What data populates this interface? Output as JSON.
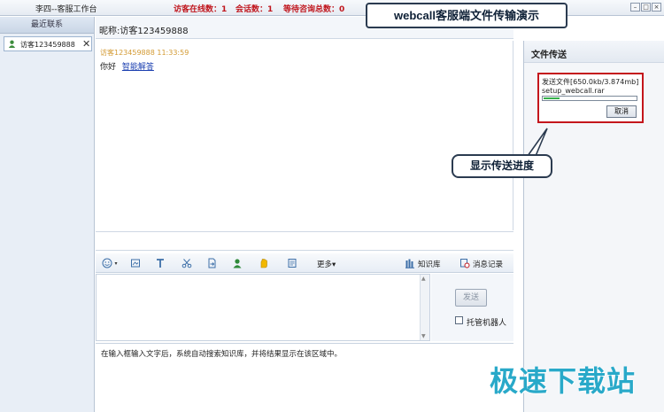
{
  "window": {
    "title": "李四--客服工作台",
    "online_visitors": "访客在线数：1",
    "sessions": "会话数：1",
    "waiting": "等待咨询总数：0",
    "controls": [
      "minimize-icon",
      "maximize-icon",
      "close-icon"
    ]
  },
  "demo_caption": "webcall客服端文件传输演示",
  "sidebar": {
    "header": "最近联系",
    "contacts": [
      {
        "name": "访客123459888",
        "icon": "visitor-avatar-icon"
      }
    ]
  },
  "conversation": {
    "nickname": "昵称:访客123459888",
    "messages": [
      {
        "meta": "访客123459888  11:33:59",
        "text": "你好",
        "link": "智能解答"
      }
    ]
  },
  "toolbar": {
    "icons": [
      "emoji-icon",
      "screenshot-icon",
      "font-icon",
      "scissors-icon",
      "file-send-icon",
      "user-icon",
      "hand-icon",
      "note-icon"
    ],
    "more_label": "更多",
    "knowledge_label": "知识库",
    "history_label": "消息记录"
  },
  "input": {
    "send_label": "发送",
    "robot_label": "托管机器人",
    "robot_checked": false
  },
  "hint": "在输入框输入文字后，系统自动搜索知识库，并将结果显示在该区域中。",
  "file_transfer": {
    "header": "文件传送",
    "status": "发送文件[650.0kb/3.874mb]",
    "filename": "setup_webcall.rar",
    "progress": 0.17,
    "cancel_label": "取消"
  },
  "callout": "显示传送进度",
  "watermark": "极速下载站",
  "colors": {
    "accent_red": "#c4161c",
    "stat_red": "#c0161d",
    "progress_green": "#35b04a",
    "watermark_blue": "#29a9c9"
  }
}
